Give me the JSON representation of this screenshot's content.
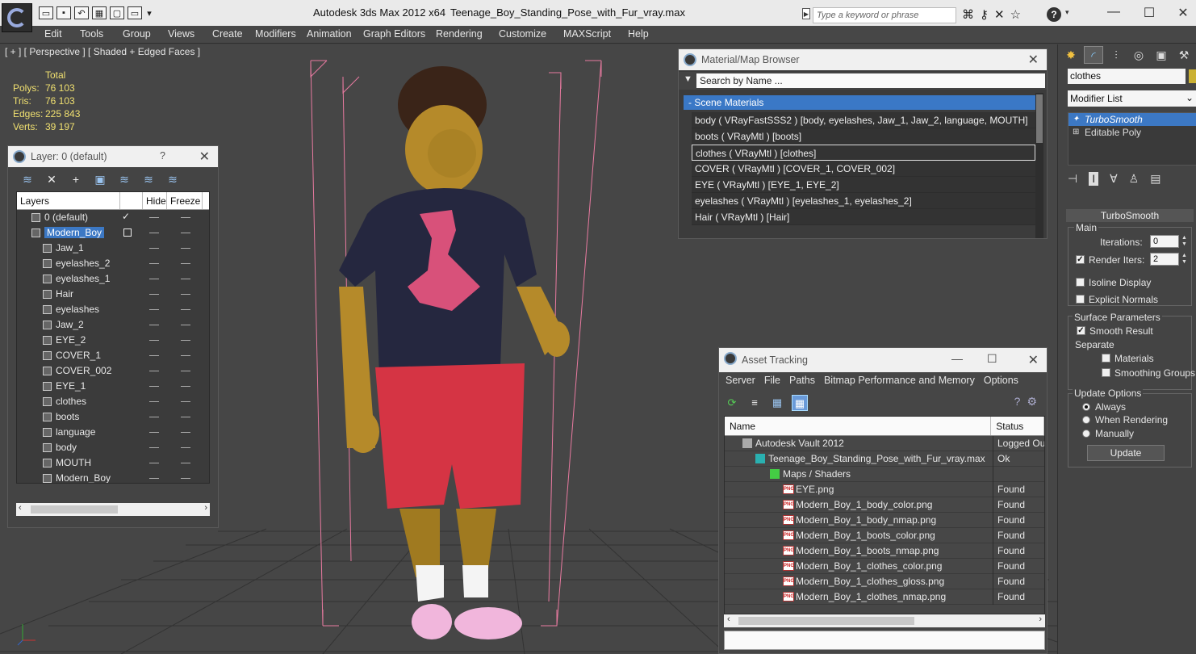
{
  "titlebar": {
    "app_title": "Autodesk 3ds Max  2012 x64",
    "file_title": "Teenage_Boy_Standing_Pose_with_Fur_vray.max",
    "search_placeholder": "Type a keyword or phrase"
  },
  "menu": [
    "Edit",
    "Tools",
    "Group",
    "Views",
    "Create",
    "Modifiers",
    "Animation",
    "Graph Editors",
    "Rendering",
    "Customize",
    "MAXScript",
    "Help"
  ],
  "viewport": {
    "label": "[ + ] [ Perspective ] [ Shaded + Edged Faces ]",
    "stats_header": "Total",
    "stats": [
      {
        "label": "Polys:",
        "value": "76 103"
      },
      {
        "label": "Tris:",
        "value": "76 103"
      },
      {
        "label": "Edges:",
        "value": "225 843"
      },
      {
        "label": "Verts:",
        "value": "39 197"
      }
    ]
  },
  "layer_dialog": {
    "title": "Layer: 0 (default)",
    "help": "?",
    "columns": [
      "Layers",
      "Hide",
      "Freeze"
    ],
    "rows": [
      {
        "name": "0 (default)",
        "level": 1
      },
      {
        "name": "Modern_Boy",
        "level": 1
      },
      {
        "name": "Jaw_1",
        "level": 2
      },
      {
        "name": "eyelashes_2",
        "level": 2
      },
      {
        "name": "eyelashes_1",
        "level": 2
      },
      {
        "name": "Hair",
        "level": 2
      },
      {
        "name": "eyelashes",
        "level": 2
      },
      {
        "name": "Jaw_2",
        "level": 2
      },
      {
        "name": "EYE_2",
        "level": 2
      },
      {
        "name": "COVER_1",
        "level": 2
      },
      {
        "name": "COVER_002",
        "level": 2
      },
      {
        "name": "EYE_1",
        "level": 2
      },
      {
        "name": "clothes",
        "level": 2
      },
      {
        "name": "boots",
        "level": 2
      },
      {
        "name": "language",
        "level": 2
      },
      {
        "name": "body",
        "level": 2
      },
      {
        "name": "MOUTH",
        "level": 2
      },
      {
        "name": "Modern_Boy",
        "level": 2
      }
    ]
  },
  "material_browser": {
    "title": "Material/Map Browser",
    "search_placeholder": "Search by Name ...",
    "section": "- Scene Materials",
    "materials": [
      "body  ( VRayFastSSS2 ) [body, eyelashes, Jaw_1, Jaw_2, language, MOUTH]",
      "boots  ( VRayMtl ) [boots]",
      "clothes  ( VRayMtl ) [clothes]",
      "COVER  ( VRayMtl ) [COVER_1, COVER_002]",
      "EYE  ( VRayMtl ) [EYE_1, EYE_2]",
      "eyelashes  ( VRayMtl ) [eyelashes_1, eyelashes_2]",
      "Hair  ( VRayMtl ) [Hair]"
    ]
  },
  "asset_tracking": {
    "title": "Asset Tracking",
    "menu": [
      "Server",
      "File",
      "Paths",
      "Bitmap Performance and Memory",
      "Options"
    ],
    "columns": [
      "Name",
      "Status"
    ],
    "rows": [
      {
        "name": "Autodesk Vault 2012",
        "status": "Logged Ou",
        "indent": 1,
        "icon": "vault-icon"
      },
      {
        "name": "Teenage_Boy_Standing_Pose_with_Fur_vray.max",
        "status": "Ok",
        "indent": 2,
        "icon": "max-file-icon"
      },
      {
        "name": "Maps / Shaders",
        "status": "",
        "indent": 3,
        "icon": "maps-icon"
      },
      {
        "name": "EYE.png",
        "status": "Found",
        "indent": 4,
        "icon": "png-icon"
      },
      {
        "name": "Modern_Boy_1_body_color.png",
        "status": "Found",
        "indent": 4,
        "icon": "png-icon"
      },
      {
        "name": "Modern_Boy_1_body_nmap.png",
        "status": "Found",
        "indent": 4,
        "icon": "png-icon"
      },
      {
        "name": "Modern_Boy_1_boots_color.png",
        "status": "Found",
        "indent": 4,
        "icon": "png-icon"
      },
      {
        "name": "Modern_Boy_1_boots_nmap.png",
        "status": "Found",
        "indent": 4,
        "icon": "png-icon"
      },
      {
        "name": "Modern_Boy_1_clothes_color.png",
        "status": "Found",
        "indent": 4,
        "icon": "png-icon"
      },
      {
        "name": "Modern_Boy_1_clothes_gloss.png",
        "status": "Found",
        "indent": 4,
        "icon": "png-icon"
      },
      {
        "name": "Modern_Boy_1_clothes_nmap.png",
        "status": "Found",
        "indent": 4,
        "icon": "png-icon"
      }
    ],
    "png_icon_text": "PNG"
  },
  "command_panel": {
    "object_name": "clothes",
    "object_color": "#cbb133",
    "modifier_list": "Modifier List",
    "stack": [
      "TurboSmooth",
      "Editable Poly"
    ],
    "rollout_title": "TurboSmooth",
    "main_label": "Main",
    "iterations_label": "Iterations:",
    "iterations_value": "0",
    "render_iters_label": "Render Iters:",
    "render_iters_value": "2",
    "isoline_label": "Isoline Display",
    "explicit_normals_label": "Explicit Normals",
    "surface_params_label": "Surface Parameters",
    "smooth_result_label": "Smooth Result",
    "separate_label": "Separate",
    "materials_label": "Materials",
    "smoothing_groups_label": "Smoothing Groups",
    "update_options_label": "Update Options",
    "always_label": "Always",
    "when_rendering_label": "When Rendering",
    "manually_label": "Manually",
    "update_button": "Update"
  },
  "colors": {
    "selection": "#3c78c4",
    "stats_text": "#f0e070",
    "bbox": "#e87aa0",
    "grid": "#2f2f2f"
  }
}
